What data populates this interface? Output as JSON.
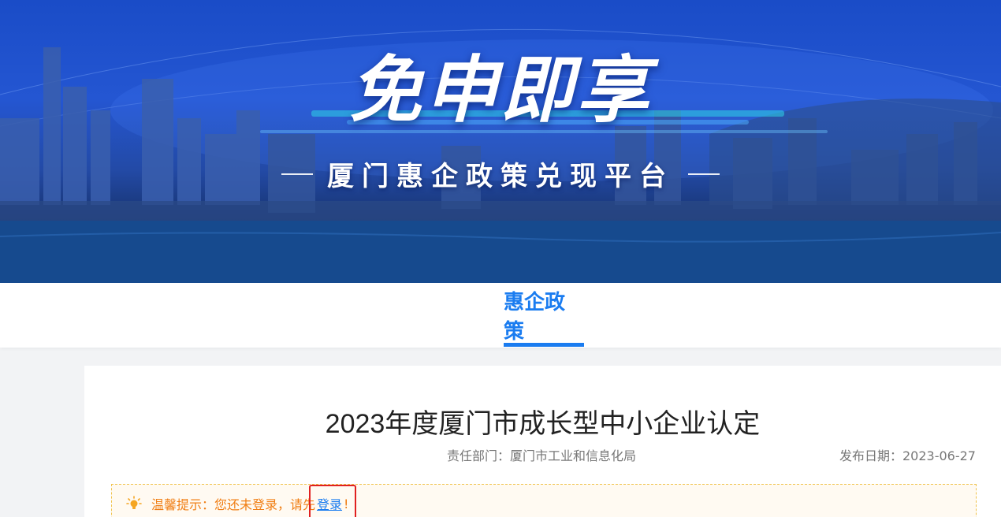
{
  "banner": {
    "title": "免申即享",
    "subtitle": "厦门惠企政策兑现平台"
  },
  "tabs": [
    {
      "label": "惠企政策",
      "active": true
    }
  ],
  "article": {
    "title": "2023年度厦门市成长型中小企业认定",
    "department": "责任部门：厦门市工业和信息化局",
    "publish_date": "发布日期：2023-06-27"
  },
  "notice": {
    "prefix": "温馨提示：您还未登录，请先",
    "link": "登录",
    "suffix": "!"
  },
  "colors": {
    "accent": "#1a7cf0",
    "notice_text": "#f07e14",
    "highlight_box": "#e02020"
  }
}
